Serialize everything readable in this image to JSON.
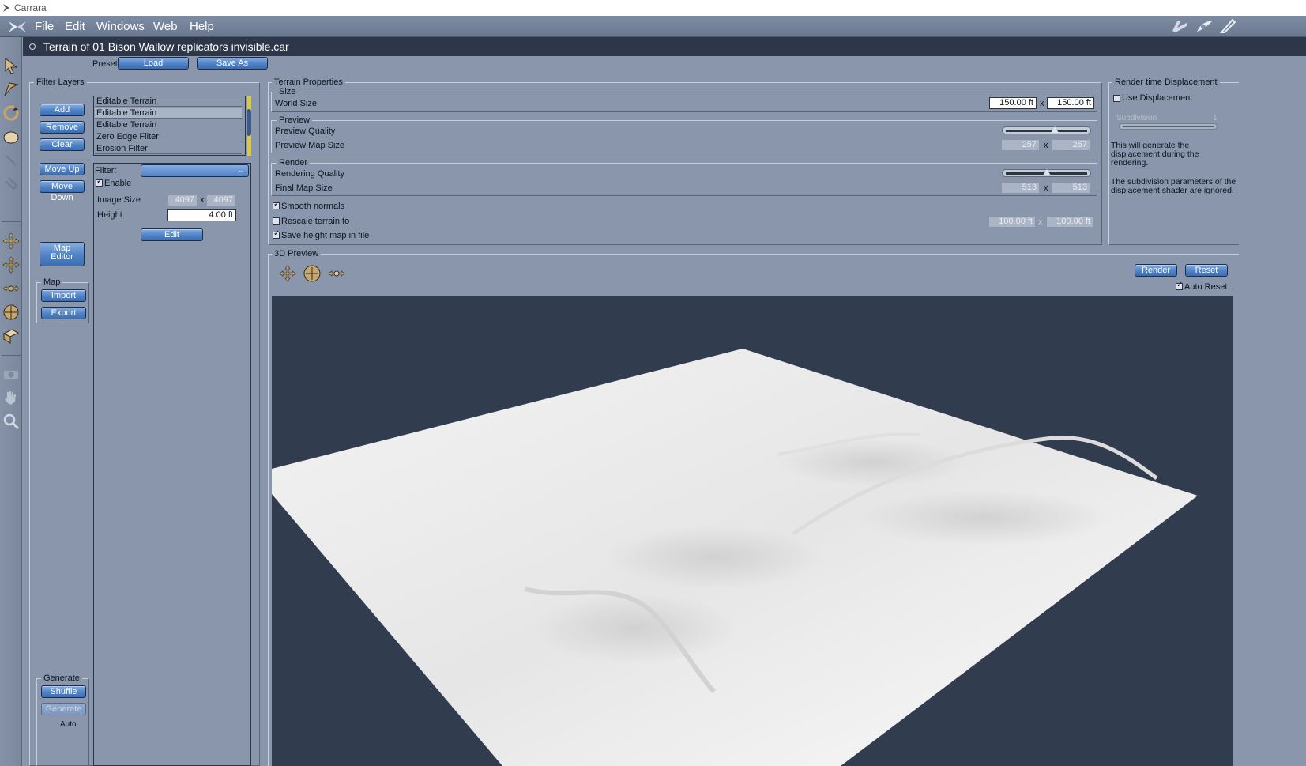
{
  "os_title": "Carrara",
  "menu": [
    "File",
    "Edit",
    "Windows",
    "Web",
    "Help"
  ],
  "document_title": "Terrain of 01 Bison Wallow replicators invisible.car",
  "preset": {
    "label": "Preset:",
    "load": "Load",
    "save_as": "Save As"
  },
  "filter_layers": {
    "title": "Filter Layers",
    "buttons": {
      "add": "Add",
      "remove": "Remove",
      "clear": "Clear",
      "move_up": "Move Up",
      "move_down": "Move Down",
      "map_editor_line1": "Map",
      "map_editor_line2": "Editor"
    },
    "list": [
      "Editable Terrain",
      "Editable Terrain",
      "Editable Terrain",
      "Zero Edge Filter",
      "Erosion Filter"
    ],
    "selected_index": 1,
    "map": {
      "title": "Map",
      "import": "Import",
      "export": "Export"
    },
    "generate": {
      "title": "Generate",
      "shuffle": "Shuffle",
      "generate": "Generate",
      "auto": "Auto"
    },
    "detail": {
      "filter_label": "Filter:",
      "enable_label": "Enable",
      "enable_checked": true,
      "image_size_label": "Image Size",
      "image_size_w": "4097",
      "image_size_h": "4097",
      "x": "x",
      "height_label": "Height",
      "height_value": "4.00 ft",
      "edit": "Edit"
    }
  },
  "terrain_properties": {
    "title": "Terrain Properties",
    "size": {
      "title": "Size",
      "world_size_label": "World Size",
      "w": "150.00 ft",
      "h": "150.00 ft"
    },
    "preview": {
      "title": "Preview",
      "quality_label": "Preview Quality",
      "quality_level": 0.6,
      "map_size_label": "Preview Map Size",
      "map_w": "257",
      "map_h": "257"
    },
    "render": {
      "title": "Render",
      "quality_label": "Rendering Quality",
      "quality_level": 0.5,
      "map_size_label": "Final Map Size",
      "map_w": "513",
      "map_h": "513"
    },
    "smooth_normals": {
      "label": "Smooth normals",
      "checked": true
    },
    "rescale": {
      "label": "Rescale terrain to",
      "checked": false,
      "w": "100.00 ft",
      "h": "100.00 ft"
    },
    "save_height": {
      "label": "Save height map in file",
      "checked": true
    },
    "x": "x"
  },
  "render_displacement": {
    "title": "Render time Displacement",
    "use_label": "Use Displacement",
    "use_checked": false,
    "subdivision_label": "Subdivision",
    "subdivision_value": "1",
    "note1": "This will generate the displacement during the rendering.",
    "note2": "The subdivision parameters of the displacement shader are ignored."
  },
  "preview3d": {
    "title": "3D Preview",
    "render": "Render",
    "reset": "Reset",
    "auto_reset_label": "Auto Reset",
    "auto_reset_checked": true
  },
  "colors": {
    "panel": "#8996ab",
    "header": "#2d3749",
    "viewport": "#323c4f",
    "button": "#4f82c6"
  }
}
